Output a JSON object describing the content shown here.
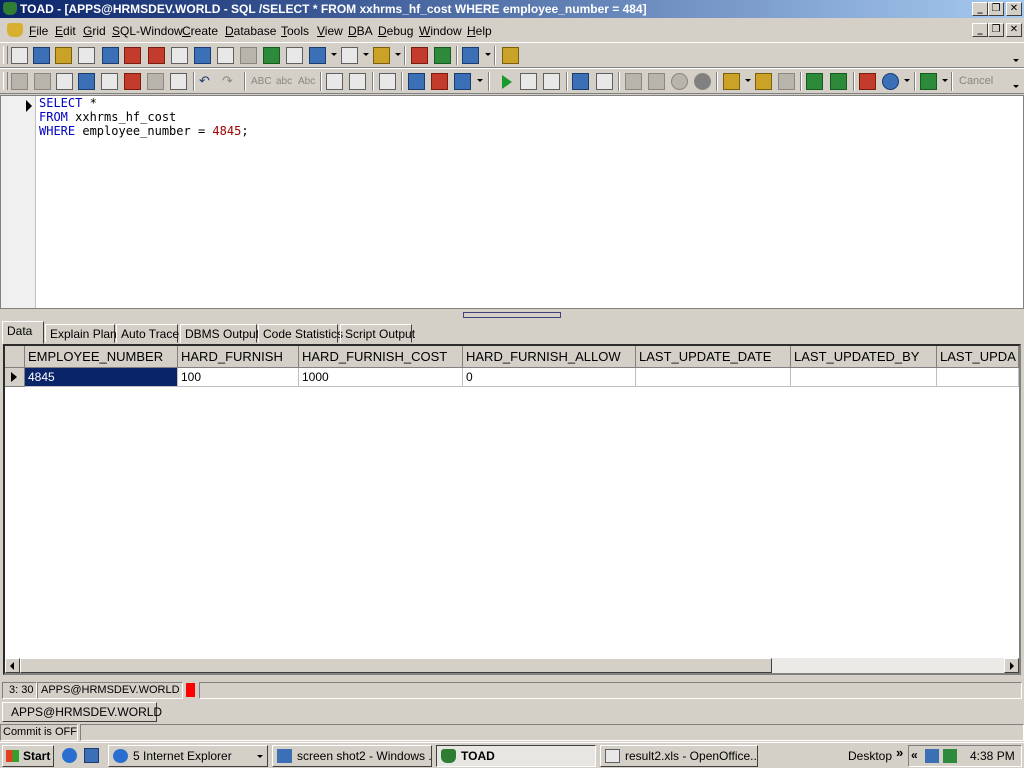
{
  "window": {
    "title": "TOAD - [APPS@HRMSDEV.WORLD - SQL /SELECT *   FROM xxhrms_hf_cost  WHERE employee_number = 484]",
    "minimize": "_",
    "restore": "❐",
    "close": "✕"
  },
  "menu": {
    "items": [
      "File",
      "Edit",
      "Grid",
      "SQL-Window",
      "Create",
      "Database",
      "Tools",
      "View",
      "DBA",
      "Debug",
      "Window",
      "Help"
    ]
  },
  "toolbar": {
    "case_labels": [
      "ABC",
      "abc",
      "Abc"
    ],
    "cancel_label": "Cancel"
  },
  "editor": {
    "line1_kw": "SELECT",
    "line1_rest": " *",
    "line2_kw": "FROM",
    "line2_rest": " xxhrms_hf_cost",
    "line3_kw": "WHERE",
    "line3_rest": " employee_number = ",
    "line3_num": "4845",
    "line3_end": ";"
  },
  "tabs": [
    "Data",
    "Explain Plan",
    "Auto Trace",
    "DBMS Output",
    "Code Statistics",
    "Script Output"
  ],
  "grid": {
    "columns": [
      "EMPLOYEE_NUMBER",
      "HARD_FURNISH",
      "HARD_FURNISH_COST",
      "HARD_FURNISH_ALLOW",
      "LAST_UPDATE_DATE",
      "LAST_UPDATED_BY",
      "LAST_UPDA"
    ],
    "rows": [
      [
        "4845",
        "100",
        "1000",
        "0",
        "",
        "",
        ""
      ]
    ]
  },
  "status": {
    "position": "3:  30",
    "connection": "APPS@HRMSDEV.WORLD",
    "connection_tab": "APPS@HRMSDEV.WORLD",
    "commit": "Commit is OFF"
  },
  "taskbar": {
    "start": "Start",
    "buttons": [
      "5 Internet Explorer",
      "screen shot2 - Windows ...",
      "TOAD",
      "result2.xls - OpenOffice...."
    ],
    "desktop": "Desktop",
    "chevron": "»",
    "chevron2": "«",
    "clock": "4:38 PM"
  },
  "colors": {
    "title_start": "#0a246a",
    "title_end": "#a6caf0",
    "selection": "#0a246a",
    "keyword": "#0000c0",
    "number": "#a00000",
    "record_indicator": "#ff0000"
  }
}
